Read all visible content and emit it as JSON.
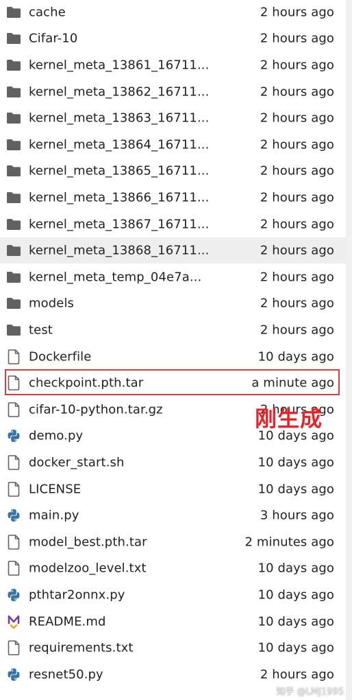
{
  "files": [
    {
      "name": "cache",
      "modified": "2 hours ago",
      "type": "folder"
    },
    {
      "name": "Cifar-10",
      "modified": "2 hours ago",
      "type": "folder"
    },
    {
      "name": "kernel_meta_13861_16711...",
      "modified": "2 hours ago",
      "type": "folder"
    },
    {
      "name": "kernel_meta_13862_16711...",
      "modified": "2 hours ago",
      "type": "folder"
    },
    {
      "name": "kernel_meta_13863_16711...",
      "modified": "2 hours ago",
      "type": "folder"
    },
    {
      "name": "kernel_meta_13864_16711...",
      "modified": "2 hours ago",
      "type": "folder"
    },
    {
      "name": "kernel_meta_13865_16711...",
      "modified": "2 hours ago",
      "type": "folder"
    },
    {
      "name": "kernel_meta_13866_16711...",
      "modified": "2 hours ago",
      "type": "folder"
    },
    {
      "name": "kernel_meta_13867_16711...",
      "modified": "2 hours ago",
      "type": "folder"
    },
    {
      "name": "kernel_meta_13868_16711...",
      "modified": "2 hours ago",
      "type": "folder"
    },
    {
      "name": "kernel_meta_temp_04e7a...",
      "modified": "2 hours ago",
      "type": "folder"
    },
    {
      "name": "models",
      "modified": "2 hours ago",
      "type": "folder"
    },
    {
      "name": "test",
      "modified": "2 hours ago",
      "type": "folder"
    },
    {
      "name": "Dockerfile",
      "modified": "10 days ago",
      "type": "file"
    },
    {
      "name": "checkpoint.pth.tar",
      "modified": "a minute ago",
      "type": "file"
    },
    {
      "name": "cifar-10-python.tar.gz",
      "modified": "2 hours ago",
      "type": "file"
    },
    {
      "name": "demo.py",
      "modified": "10 days ago",
      "type": "python"
    },
    {
      "name": "docker_start.sh",
      "modified": "10 days ago",
      "type": "file"
    },
    {
      "name": "LICENSE",
      "modified": "10 days ago",
      "type": "file"
    },
    {
      "name": "main.py",
      "modified": "3 hours ago",
      "type": "python"
    },
    {
      "name": "model_best.pth.tar",
      "modified": "2 minutes ago",
      "type": "file"
    },
    {
      "name": "modelzoo_level.txt",
      "modified": "10 days ago",
      "type": "file"
    },
    {
      "name": "pthtar2onnx.py",
      "modified": "10 days ago",
      "type": "python"
    },
    {
      "name": "README.md",
      "modified": "10 days ago",
      "type": "markdown"
    },
    {
      "name": "requirements.txt",
      "modified": "10 days ago",
      "type": "file"
    },
    {
      "name": "resnet50.py",
      "modified": "2 hours ago",
      "type": "python"
    }
  ],
  "hovered_index": 9,
  "highlighted_index": 14,
  "annotation": {
    "text": "刚生成",
    "color": "#e8232a"
  },
  "watermark": "知乎 @LMJ1995",
  "colors": {
    "folder_icon": "#616161",
    "file_icon": "#616161",
    "python_blue": "#3572A5",
    "python_yellow": "#FFD43B",
    "markdown_purple": "#7b3fa0",
    "text": "#212121",
    "hover_bg": "#eeeeee",
    "highlight_border": "#e03a3e"
  }
}
